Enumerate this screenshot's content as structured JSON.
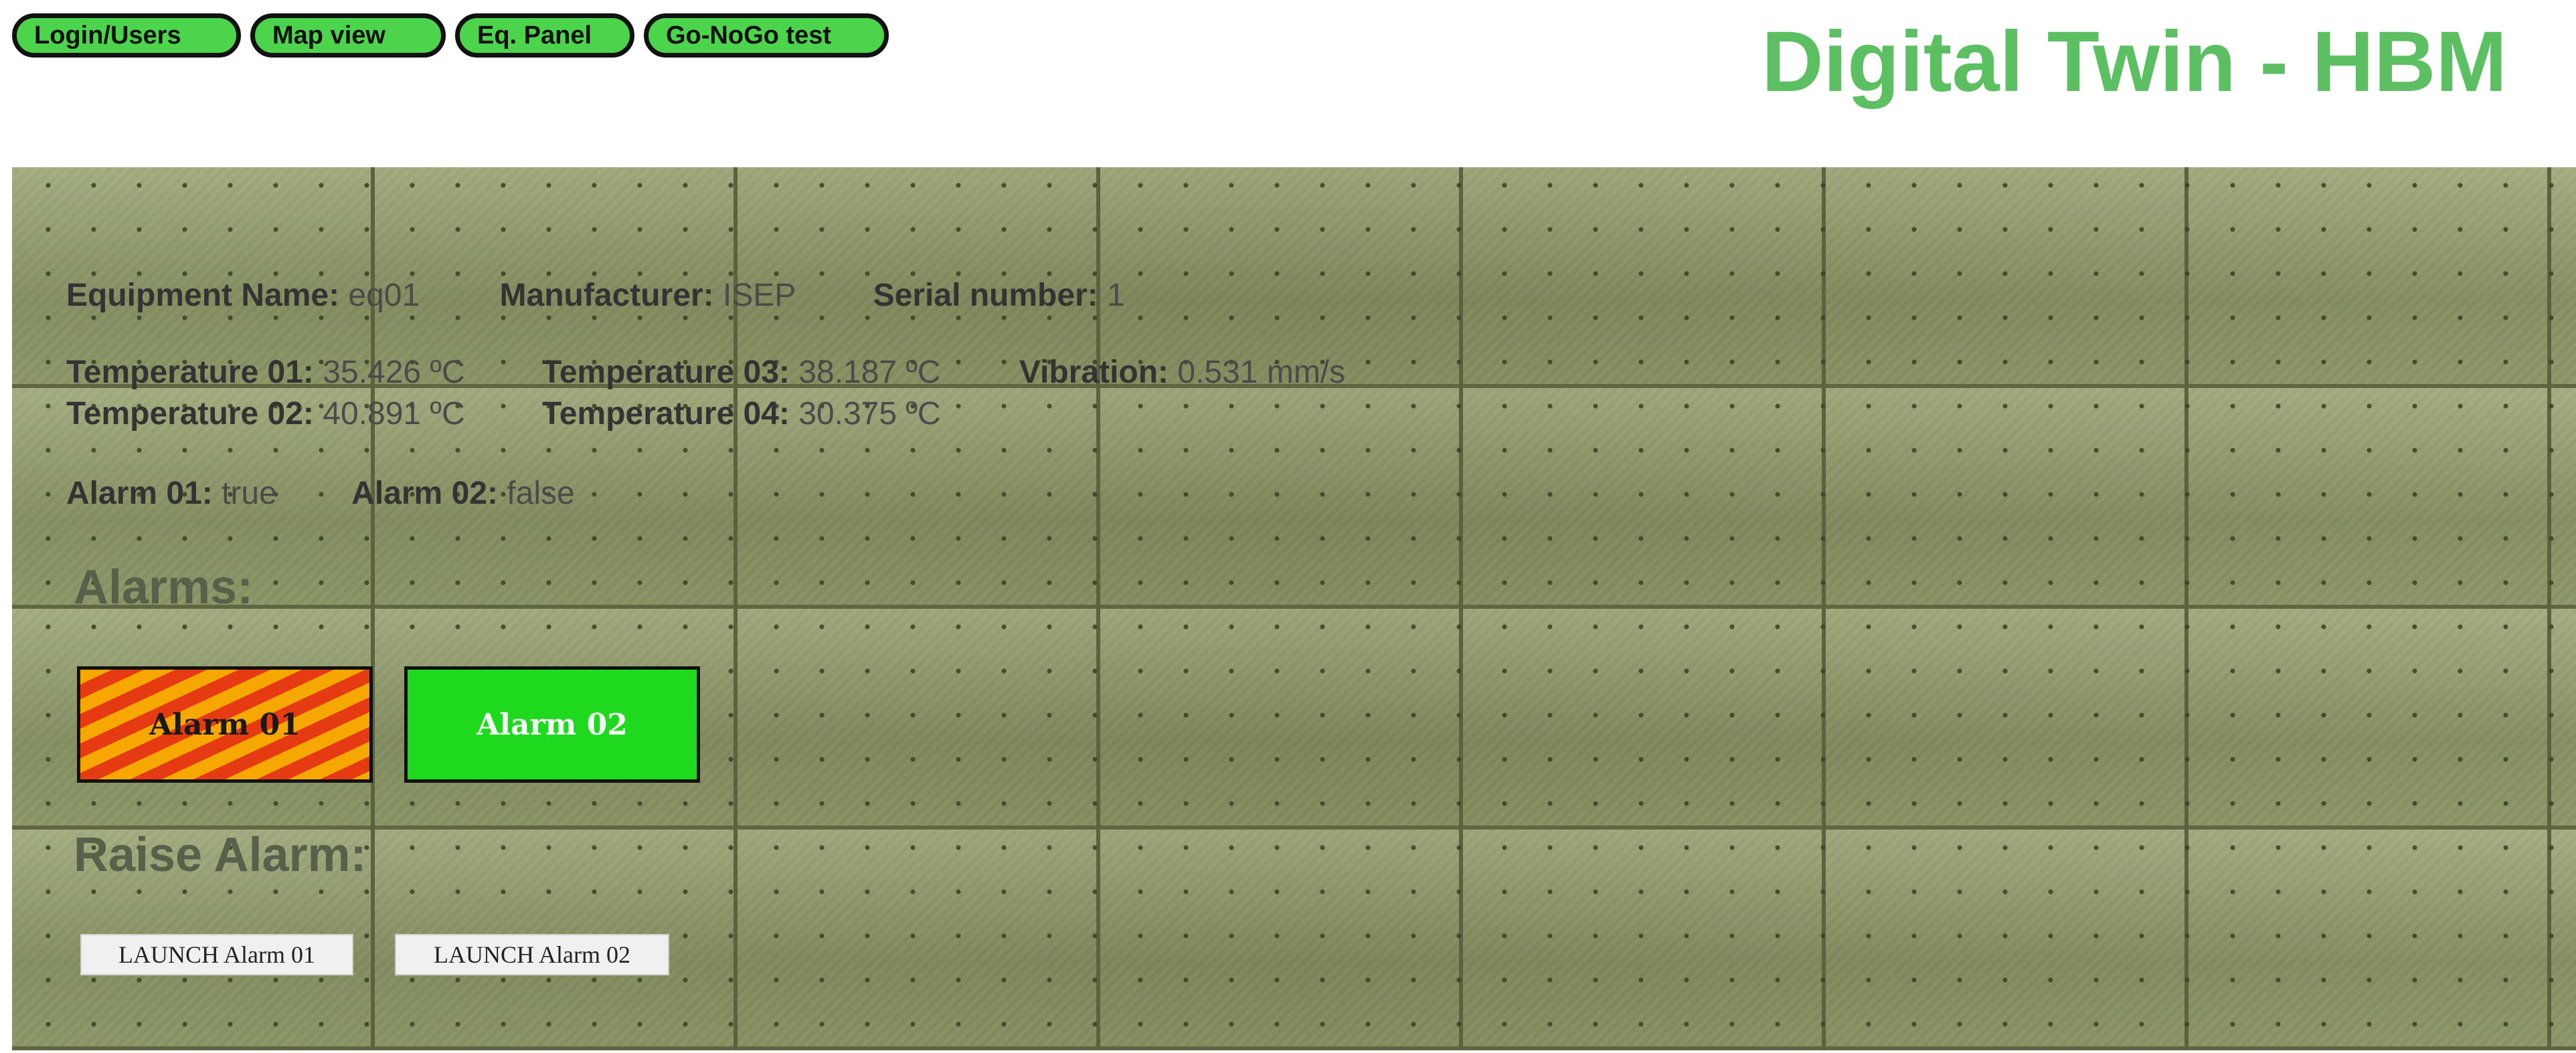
{
  "nav": {
    "items": [
      {
        "label": "Login/Users"
      },
      {
        "label": "Map view"
      },
      {
        "label": "Eq. Panel"
      },
      {
        "label": "Go-NoGo test"
      }
    ]
  },
  "header": {
    "title": "Digital Twin - HBM"
  },
  "equipment": {
    "name_label": "Equipment Name:",
    "name_value": "eq01",
    "manufacturer_label": "Manufacturer:",
    "manufacturer_value": "ISEP",
    "serial_label": "Serial number:",
    "serial_value": "1"
  },
  "readings": {
    "temp01_label": "Temperature 01:",
    "temp01_value": "35.426 ºC",
    "temp03_label": "Temperature 03:",
    "temp03_value": "38.187 ºC",
    "vibration_label": "Vibration:",
    "vibration_value": "0.531 mm/s",
    "temp02_label": "Temperature 02:",
    "temp02_value": "40.891 ºC",
    "temp04_label": "Temperature 04:",
    "temp04_value": "30.375 ºC"
  },
  "alarm_status": {
    "alarm01_label": "Alarm 01:",
    "alarm01_value": "true",
    "alarm02_label": "Alarm 02:",
    "alarm02_value": "false"
  },
  "alarms": {
    "title": "Alarms:",
    "alarm01": "Alarm 01",
    "alarm02": "Alarm 02"
  },
  "raise": {
    "title": "Raise Alarm:",
    "launch01": "LAUNCH Alarm 01",
    "launch02": "LAUNCH Alarm 02"
  },
  "colors": {
    "nav_button_bg": "#4cd44c",
    "title": "#5cc062",
    "alarm_active_stripe_a": "#f7a800",
    "alarm_active_stripe_b": "#e63b12",
    "alarm_inactive": "#1ed91e",
    "panel_metal": "#8c9866"
  }
}
